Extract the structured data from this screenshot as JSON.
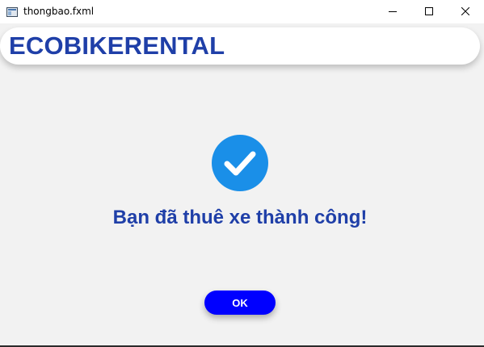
{
  "window": {
    "title": "thongbao.fxml",
    "icons": {
      "app": "window-app-icon",
      "minimize": "minimize-icon",
      "maximize": "maximize-icon",
      "close": "close-icon"
    }
  },
  "header": {
    "brand": "ECOBIKERENTAL"
  },
  "main": {
    "icon": "checkmark-circle-icon",
    "message": "Bạn đã thuê xe thành công!",
    "ok_label": "OK"
  },
  "colors": {
    "brand_text": "#1f3fa8",
    "check_circle": "#1a8fe8",
    "ok_button": "#0000ff",
    "background": "#f2f2f2"
  }
}
